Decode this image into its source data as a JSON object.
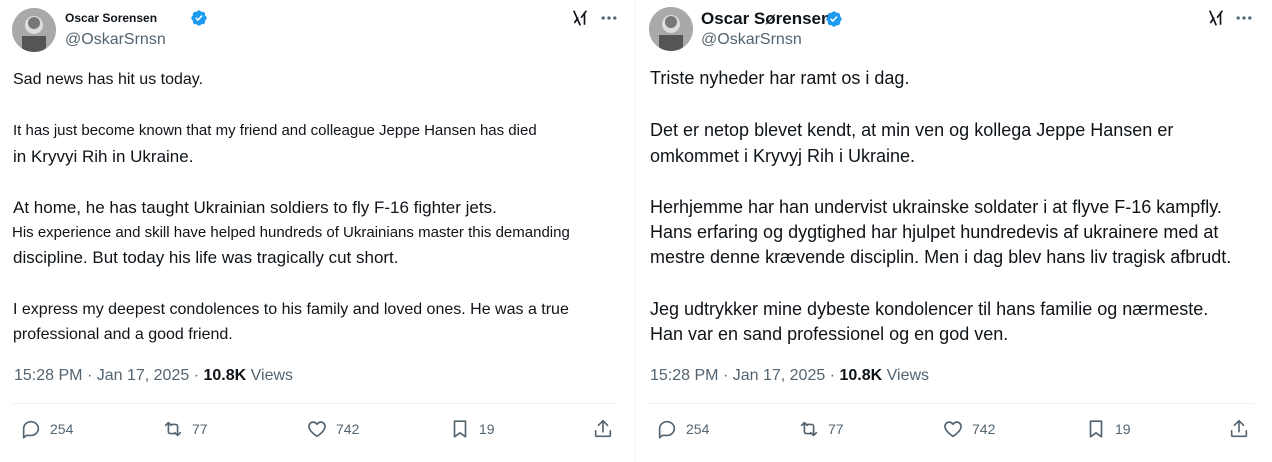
{
  "left": {
    "author": {
      "name": "Oscar Sorensen",
      "handle": "@OskarSrnsn",
      "verified": true
    },
    "lines": [
      "Sad news has hit us today.",
      "It has just become known that my friend and colleague Jeppe Hansen has died",
      "in Kryvyi Rih in Ukraine.",
      "At home, he has taught Ukrainian soldiers to fly F-16 fighter jets.",
      "His experience and skill have helped hundreds of Ukrainians master this demanding",
      "discipline. But today his life was tragically cut short.",
      "I express my deepest condolences to his family and loved ones. He was a true",
      "professional and a good friend."
    ],
    "meta": {
      "time": "15:28 PM",
      "dot": "·",
      "date": "Jan 17, 2025",
      "views_count": "10.8K",
      "views_label": "Views"
    },
    "actions": {
      "replies": "254",
      "reposts": "77",
      "likes": "742",
      "bookmarks": "19"
    }
  },
  "right": {
    "author": {
      "name": "Oscar Sørensen",
      "handle": "@OskarSrnsn",
      "verified": true
    },
    "lines": [
      "Triste nyheder har ramt os i dag.",
      "Det er netop blevet kendt, at min ven og kollega Jeppe Hansen er",
      "omkommet i Kryvyj Rih i Ukraine.",
      "Herhjemme har han undervist ukrainske soldater i at flyve F-16 kampfly.",
      "Hans erfaring og dygtighed har hjulpet hundredevis af ukrainere med at",
      "mestre denne krævende disciplin. Men i dag blev hans liv tragisk afbrudt.",
      "Jeg udtrykker mine dybeste kondolencer til hans familie og nærmeste.",
      "Han var en sand professionel og en god ven."
    ],
    "meta": {
      "time": "15:28 PM",
      "dot": "·",
      "date": "Jan 17, 2025",
      "views_count": "10.8K",
      "views_label": "Views"
    },
    "actions": {
      "replies": "254",
      "reposts": "77",
      "likes": "742",
      "bookmarks": "19"
    }
  },
  "icons": {
    "verified": "verified-badge-icon",
    "x_logo": "grok-icon",
    "more": "more-icon",
    "reply": "reply-icon",
    "repost": "repost-icon",
    "like": "heart-icon",
    "bookmark": "bookmark-icon",
    "share": "share-icon"
  },
  "colors": {
    "verified": "#1d9bf0",
    "text": "#0f1419",
    "muted": "#536471"
  }
}
